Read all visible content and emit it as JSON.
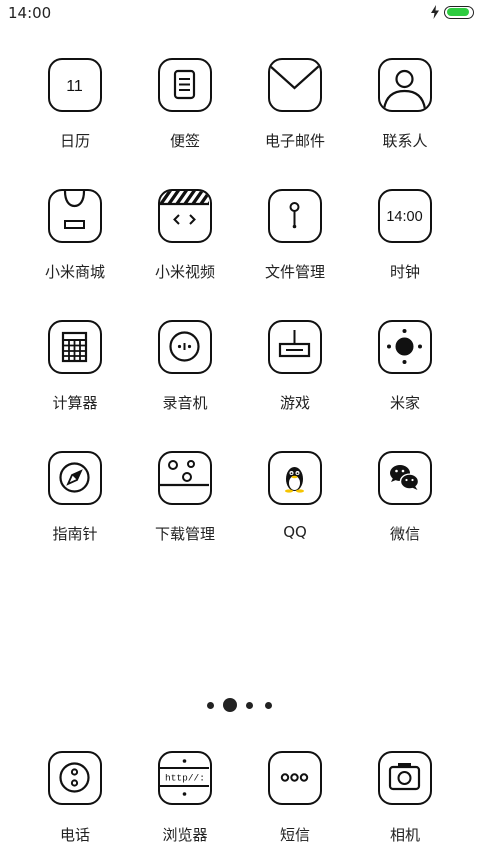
{
  "status_bar": {
    "time": "14:00",
    "charging_icon": "lightning-bolt-icon",
    "battery_level": 0.9,
    "battery_color": "#2ecc40"
  },
  "apps": [
    {
      "id": "calendar",
      "label": "日历",
      "icon": "calendar-icon",
      "text": "11"
    },
    {
      "id": "notes",
      "label": "便签",
      "icon": "notes-icon"
    },
    {
      "id": "email",
      "label": "电子邮件",
      "icon": "envelope-icon"
    },
    {
      "id": "contacts",
      "label": "联系人",
      "icon": "person-icon"
    },
    {
      "id": "mi-store",
      "label": "小米商城",
      "icon": "shopping-bag-icon"
    },
    {
      "id": "mi-video",
      "label": "小米视频",
      "icon": "clapperboard-icon"
    },
    {
      "id": "file-manager",
      "label": "文件管理",
      "icon": "file-pin-icon"
    },
    {
      "id": "clock",
      "label": "时钟",
      "icon": "clock-icon",
      "text": "14:00"
    },
    {
      "id": "calculator",
      "label": "计算器",
      "icon": "calculator-icon"
    },
    {
      "id": "recorder",
      "label": "录音机",
      "icon": "recorder-icon"
    },
    {
      "id": "games",
      "label": "游戏",
      "icon": "game-controller-icon"
    },
    {
      "id": "mi-home",
      "label": "米家",
      "icon": "mi-home-icon"
    },
    {
      "id": "compass",
      "label": "指南针",
      "icon": "compass-icon"
    },
    {
      "id": "downloads",
      "label": "下载管理",
      "icon": "download-icon"
    },
    {
      "id": "qq",
      "label": "QQ",
      "icon": "qq-penguin-icon"
    },
    {
      "id": "wechat",
      "label": "微信",
      "icon": "wechat-icon"
    }
  ],
  "page_indicator": {
    "count": 4,
    "active": 1
  },
  "dock": [
    {
      "id": "phone",
      "label": "电话",
      "icon": "phone-icon"
    },
    {
      "id": "browser",
      "label": "浏览器",
      "icon": "browser-icon",
      "text": "http//:"
    },
    {
      "id": "messages",
      "label": "短信",
      "icon": "messages-icon"
    },
    {
      "id": "camera",
      "label": "相机",
      "icon": "camera-icon"
    }
  ]
}
